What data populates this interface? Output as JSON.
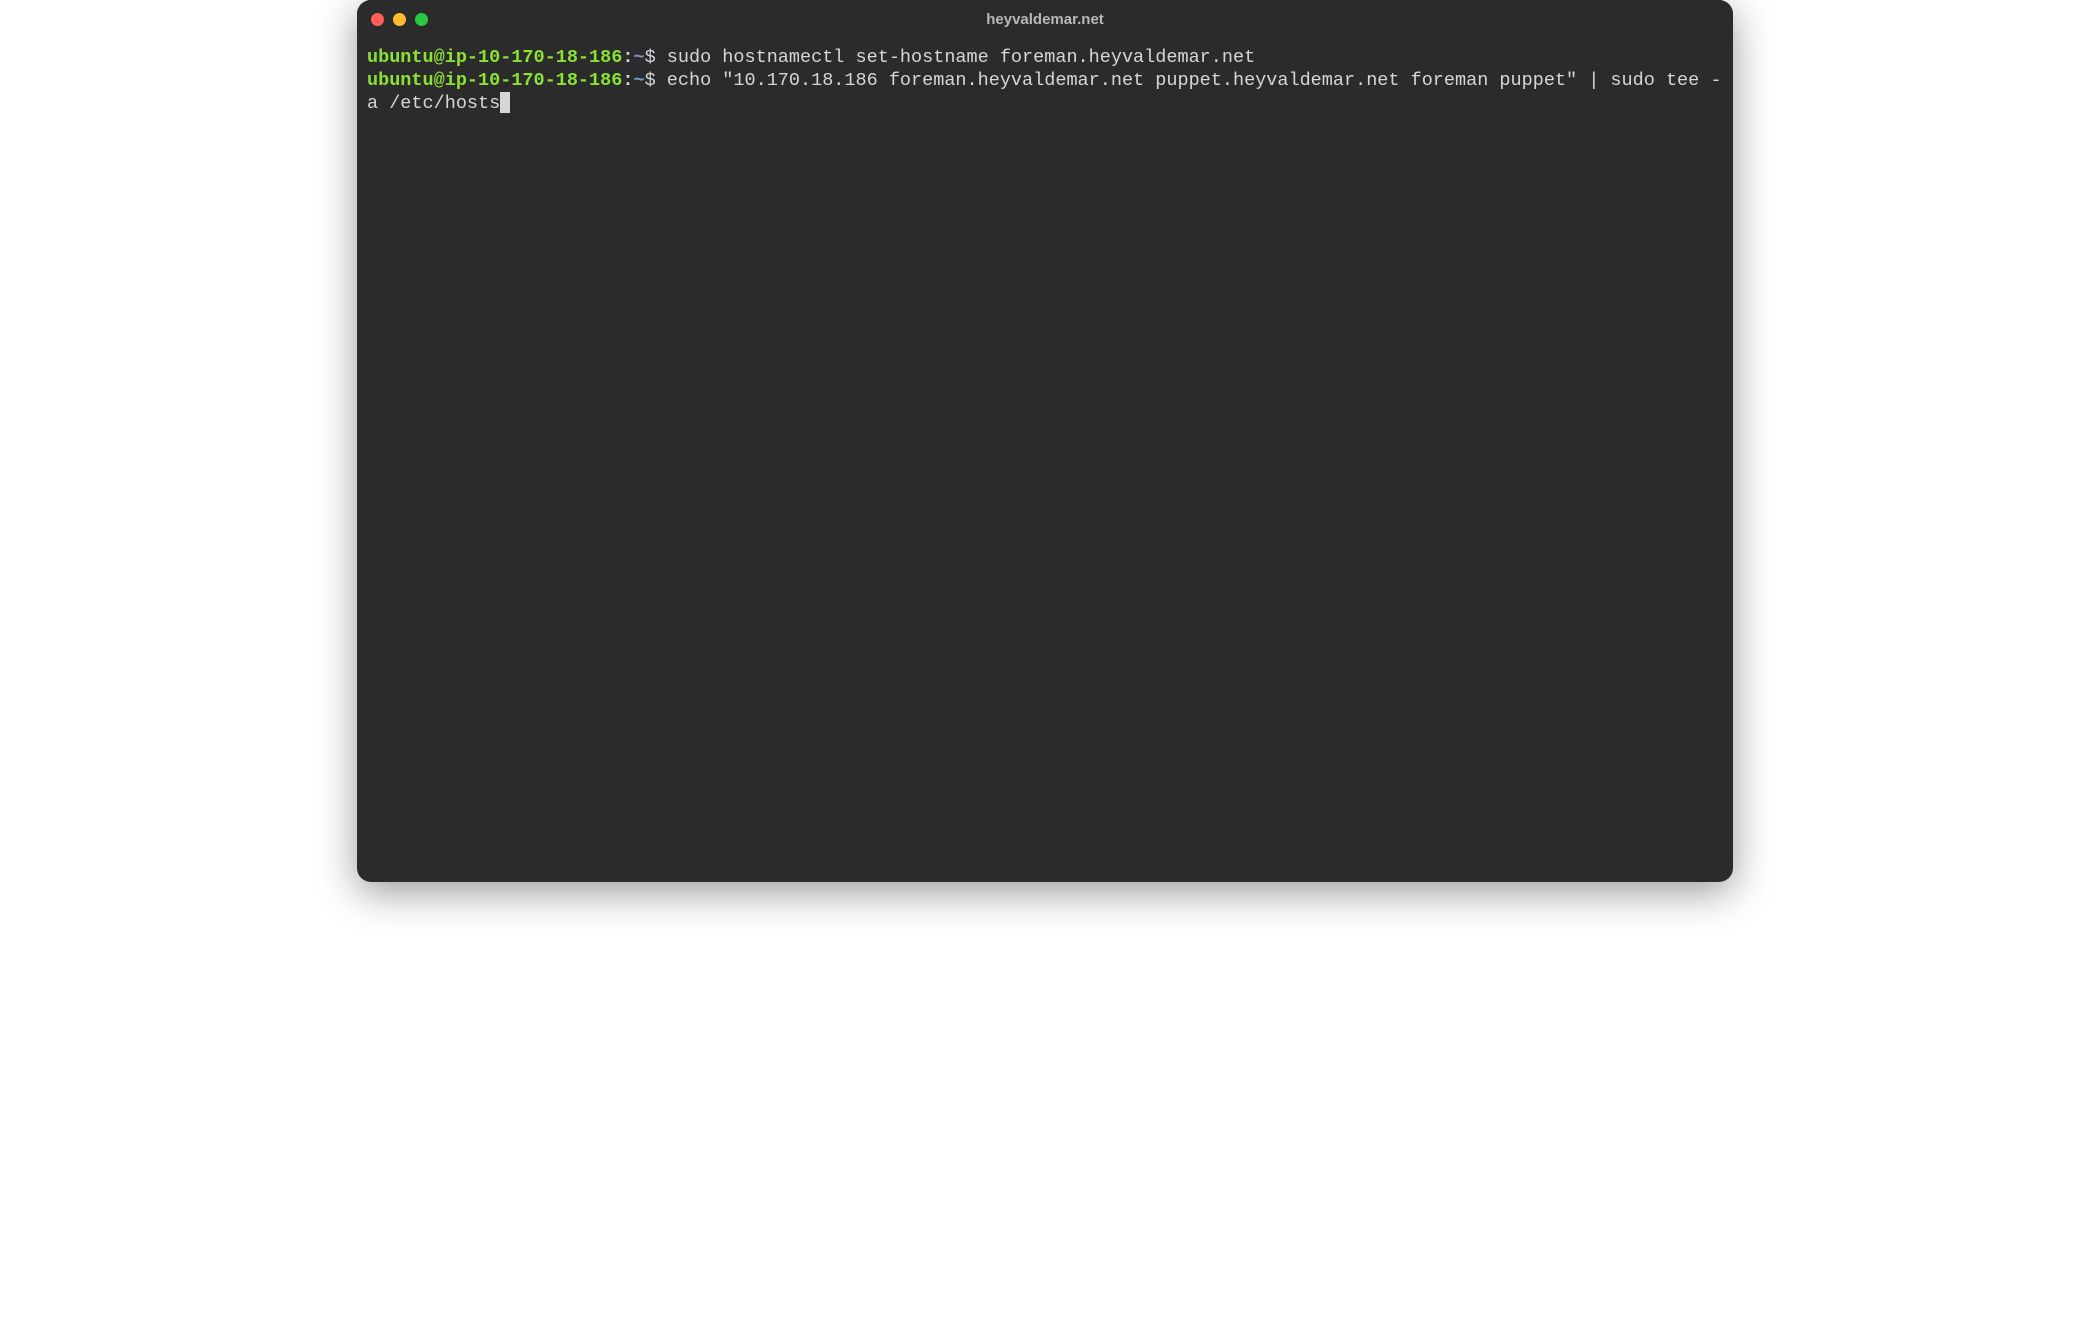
{
  "window": {
    "title": "heyvaldemar.net"
  },
  "prompt": {
    "user_host": "ubuntu@ip-10-170-18-186",
    "colon": ":",
    "cwd": "~",
    "symbol": "$"
  },
  "lines": [
    {
      "command": "sudo hostnamectl set-hostname foreman.heyvaldemar.net",
      "cursor": false
    },
    {
      "command": "echo \"10.170.18.186 foreman.heyvaldemar.net puppet.heyvaldemar.net foreman puppet\" | sudo tee -a /etc/hosts",
      "cursor": true
    }
  ]
}
